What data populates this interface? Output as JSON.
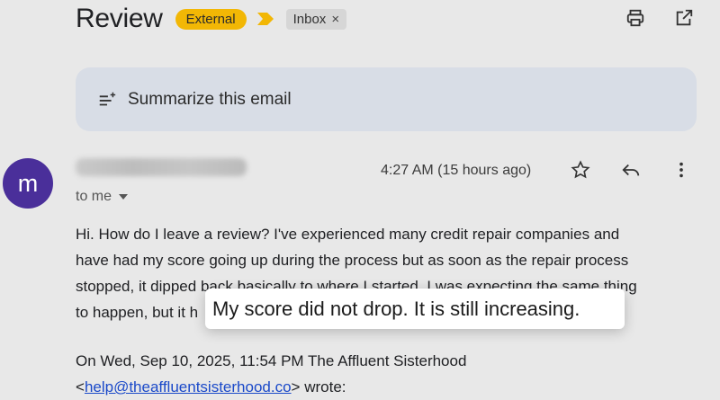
{
  "header": {
    "title": "Review",
    "badge": "External",
    "label_chip": "Inbox",
    "label_chip_close": "×"
  },
  "summarize": {
    "label": "Summarize this email"
  },
  "message": {
    "avatar_letter": "m",
    "time": "4:27 AM (15 hours ago)",
    "recipient": "to me",
    "body_lines": [
      "Hi. How do I leave a review? I've experienced many credit repair companies and",
      "have had my score going up during the process but as soon as the repair process",
      "stopped, it dipped back basically to where I started. I was expecting the same thing",
      "to happen, but it h"
    ],
    "highlight": "My score did not drop. It is still increasing.",
    "quote_line1": "On Wed, Sep 10, 2025, 11:54 PM The Affluent Sisterhood",
    "quote_lt": "<",
    "quote_email": "help@theaffluentsisterhood.co",
    "quote_end": "> wrote:"
  },
  "colors": {
    "badge_external": "#f2b705",
    "avatar": "#4a2f9a",
    "link": "#1a49c9",
    "summarize_bg": "#d8dde6"
  },
  "icons": [
    "print-icon",
    "open-in-new-icon",
    "sparkle-list-icon",
    "star-icon",
    "reply-icon",
    "more-vert-icon"
  ]
}
